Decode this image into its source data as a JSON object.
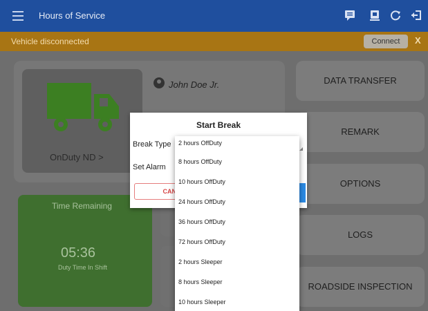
{
  "appbar": {
    "title": "Hours of Service"
  },
  "status": {
    "message": "Vehicle disconnected",
    "connect_label": "Connect",
    "close_label": "X"
  },
  "driver": {
    "name": "John Doe Jr.",
    "status_label": "OnDuty ND  >"
  },
  "time": {
    "title": "Time Remaining",
    "value": "05:36",
    "subtitle": "Duty Time In Shift"
  },
  "side_buttons": [
    "DATA TRANSFER",
    "REMARK",
    "OPTIONS",
    "LOGS",
    "ROADSIDE INSPECTION"
  ],
  "dialog": {
    "title": "Start Break",
    "break_type_label": "Break Type",
    "set_alarm_label": "Set Alarm",
    "cancel_label": "CAN"
  },
  "dropdown": {
    "options": [
      "2 hours OffDuty",
      "8 hours OffDuty",
      "10 hours OffDuty",
      "24 hours OffDuty",
      "36 hours OffDuty",
      "72 hours OffDuty",
      "2 hours Sleeper",
      "8 hours Sleeper",
      "10 hours Sleeper"
    ]
  },
  "colors": {
    "appbar": "#1f4f9e",
    "status_bar": "#a87514",
    "time_card": "#3f6f2f",
    "truck": "#3c7f22",
    "accent": "#2c8be5"
  },
  "icons": {
    "menu": "menu-icon",
    "chat": "message-icon",
    "device": "device-icon",
    "refresh": "refresh-icon",
    "logout": "logout-icon",
    "user": "user-icon",
    "truck": "truck-icon"
  }
}
